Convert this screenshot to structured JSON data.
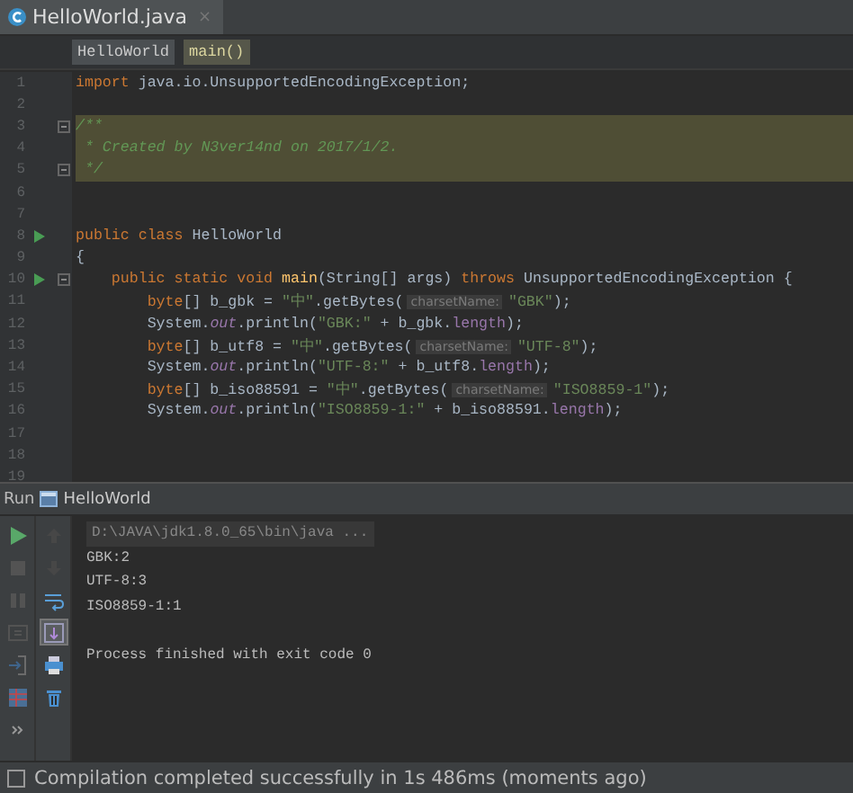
{
  "tab": {
    "title": "HelloWorld.java",
    "close": "×",
    "selected": true
  },
  "breadcrumbs": [
    {
      "label": "HelloWorld",
      "selected": false
    },
    {
      "label": "main()",
      "selected": true
    }
  ],
  "code_lines": [
    {
      "number": "1",
      "run": false,
      "fold": false,
      "highlighted": false,
      "tokens": [
        {
          "kind": "keyword",
          "text": "import"
        },
        {
          "kind": "plain",
          "text": " java.io.UnsupportedEncodingException;"
        }
      ]
    },
    {
      "number": "2",
      "run": false,
      "fold": false,
      "highlighted": false
    },
    {
      "number": "3",
      "run": false,
      "fold": true,
      "highlighted": true,
      "tokens": [
        {
          "kind": "comment",
          "text": "/**"
        }
      ]
    },
    {
      "number": "4",
      "run": false,
      "fold": false,
      "highlighted": true,
      "tokens": [
        {
          "kind": "comment",
          "text": " * Created by N3ver14nd on 2017/1/2."
        }
      ]
    },
    {
      "number": "5",
      "run": false,
      "fold": true,
      "highlighted": true,
      "tokens": [
        {
          "kind": "comment",
          "text": " */"
        }
      ]
    },
    {
      "number": "6",
      "run": false,
      "fold": false,
      "highlighted": false
    },
    {
      "number": "7",
      "run": false,
      "fold": false,
      "highlighted": false
    },
    {
      "number": "8",
      "run": true,
      "fold": false,
      "highlighted": false,
      "tokens": [
        {
          "kind": "keyword",
          "text": "public class"
        },
        {
          "kind": "plain",
          "text": " HelloWorld"
        }
      ]
    },
    {
      "number": "9",
      "run": false,
      "fold": false,
      "highlighted": false,
      "tokens": [
        {
          "kind": "plain",
          "text": "{"
        }
      ]
    },
    {
      "number": "10",
      "run": true,
      "fold": true,
      "highlighted": false,
      "tokens": [
        {
          "kind": "keyword",
          "text": "    public static void"
        },
        {
          "kind": "method",
          "text": " main"
        },
        {
          "kind": "plain",
          "text": "(String[] args) "
        },
        {
          "kind": "keyword",
          "text": "throws"
        },
        {
          "kind": "plain",
          "text": " UnsupportedEncodingException {"
        }
      ]
    },
    {
      "number": "11",
      "run": false,
      "fold": false,
      "highlighted": false,
      "tokens": [
        {
          "kind": "keyword",
          "text": "        byte"
        },
        {
          "kind": "plain",
          "text": "[] b_gbk = "
        },
        {
          "kind": "string",
          "text": "\"中\""
        },
        {
          "kind": "plain",
          "text": ".getBytes("
        },
        {
          "kind": "hint",
          "text": "charsetName:"
        },
        {
          "kind": "string",
          "text": "\"GBK\""
        },
        {
          "kind": "plain",
          "text": ");"
        }
      ]
    },
    {
      "number": "12",
      "run": false,
      "fold": false,
      "highlighted": false,
      "tokens": [
        {
          "kind": "plain",
          "text": "        System."
        },
        {
          "kind": "field",
          "text": "out"
        },
        {
          "kind": "plain",
          "text": ".println("
        },
        {
          "kind": "string",
          "text": "\"GBK:\""
        },
        {
          "kind": "plain",
          "text": " + b_gbk."
        },
        {
          "kind": "member",
          "text": "length"
        },
        {
          "kind": "plain",
          "text": ");"
        }
      ]
    },
    {
      "number": "13",
      "run": false,
      "fold": false,
      "highlighted": false,
      "tokens": [
        {
          "kind": "keyword",
          "text": "        byte"
        },
        {
          "kind": "plain",
          "text": "[] b_utf8 = "
        },
        {
          "kind": "string",
          "text": "\"中\""
        },
        {
          "kind": "plain",
          "text": ".getBytes("
        },
        {
          "kind": "hint",
          "text": "charsetName:"
        },
        {
          "kind": "string",
          "text": "\"UTF-8\""
        },
        {
          "kind": "plain",
          "text": ");"
        }
      ]
    },
    {
      "number": "14",
      "run": false,
      "fold": false,
      "highlighted": false,
      "tokens": [
        {
          "kind": "plain",
          "text": "        System."
        },
        {
          "kind": "field",
          "text": "out"
        },
        {
          "kind": "plain",
          "text": ".println("
        },
        {
          "kind": "string",
          "text": "\"UTF-8:\""
        },
        {
          "kind": "plain",
          "text": " + b_utf8."
        },
        {
          "kind": "member",
          "text": "length"
        },
        {
          "kind": "plain",
          "text": ");"
        }
      ]
    },
    {
      "number": "15",
      "run": false,
      "fold": false,
      "highlighted": false,
      "tokens": [
        {
          "kind": "keyword",
          "text": "        byte"
        },
        {
          "kind": "plain",
          "text": "[] b_iso88591 = "
        },
        {
          "kind": "string",
          "text": "\"中\""
        },
        {
          "kind": "plain",
          "text": ".getBytes("
        },
        {
          "kind": "hint",
          "text": "charsetName:"
        },
        {
          "kind": "string",
          "text": "\"ISO8859-1\""
        },
        {
          "kind": "plain",
          "text": ");"
        }
      ]
    },
    {
      "number": "16",
      "run": false,
      "fold": false,
      "highlighted": false,
      "tokens": [
        {
          "kind": "plain",
          "text": "        System."
        },
        {
          "kind": "field",
          "text": "out"
        },
        {
          "kind": "plain",
          "text": ".println("
        },
        {
          "kind": "string",
          "text": "\"ISO8859-1:\""
        },
        {
          "kind": "plain",
          "text": " + b_iso88591."
        },
        {
          "kind": "member",
          "text": "length"
        },
        {
          "kind": "plain",
          "text": ");"
        }
      ]
    },
    {
      "number": "17",
      "run": false,
      "fold": false,
      "highlighted": false
    },
    {
      "number": "18",
      "run": false,
      "fold": false,
      "highlighted": false
    },
    {
      "number": "19",
      "run": false,
      "fold": false,
      "highlighted": false
    }
  ],
  "run_panel": {
    "label": "Run",
    "config": "HelloWorld",
    "toolbar_left": [
      {
        "kind": "run",
        "disabled": false
      },
      {
        "kind": "stop",
        "disabled": true
      },
      {
        "kind": "pause",
        "disabled": true
      },
      {
        "kind": "dump",
        "disabled": true
      },
      {
        "kind": "exit",
        "disabled": true
      },
      {
        "kind": "layout",
        "disabled": false
      },
      {
        "kind": "more",
        "disabled": false
      }
    ],
    "toolbar_right": [
      {
        "kind": "up",
        "disabled": true,
        "selected": false
      },
      {
        "kind": "down",
        "disabled": true,
        "selected": false
      },
      {
        "kind": "wrap",
        "disabled": false,
        "selected": false
      },
      {
        "kind": "scroll",
        "disabled": false,
        "selected": true
      },
      {
        "kind": "print",
        "disabled": false,
        "selected": false
      },
      {
        "kind": "trash",
        "disabled": false,
        "selected": false
      }
    ],
    "console": [
      {
        "kind": "command",
        "text": "D:\\JAVA\\jdk1.8.0_65\\bin\\java ..."
      },
      {
        "kind": "output",
        "text": "GBK:2"
      },
      {
        "kind": "output",
        "text": "UTF-8:3"
      },
      {
        "kind": "output",
        "text": "ISO8859-1:1"
      },
      {
        "kind": "blank"
      },
      {
        "kind": "output",
        "text": "Process finished with exit code 0"
      }
    ]
  },
  "status_bar": {
    "message": "Compilation completed successfully in 1s 486ms (moments ago)"
  }
}
